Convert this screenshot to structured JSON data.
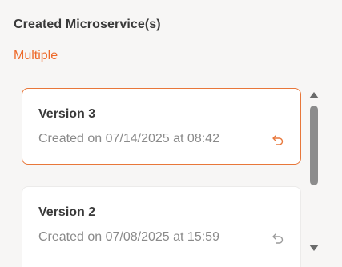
{
  "section": {
    "title": "Created Microservice(s)",
    "value": "Multiple"
  },
  "versions": [
    {
      "title": "Version 3",
      "created": "Created on 07/14/2025 at 08:42",
      "selected": true,
      "restore_icon": "undo-arrow-icon"
    },
    {
      "title": "Version 2",
      "created": "Created on 07/08/2025 at 15:59",
      "selected": false,
      "restore_icon": "undo-arrow-icon"
    }
  ],
  "colors": {
    "accent": "#ee6a2a",
    "selected_border": "#e8773a",
    "icon_selected": "#e8773a",
    "icon_default": "#9a9a9a",
    "scrollbar": "#8c8c8c"
  },
  "scrollbar": {
    "visible": true
  }
}
